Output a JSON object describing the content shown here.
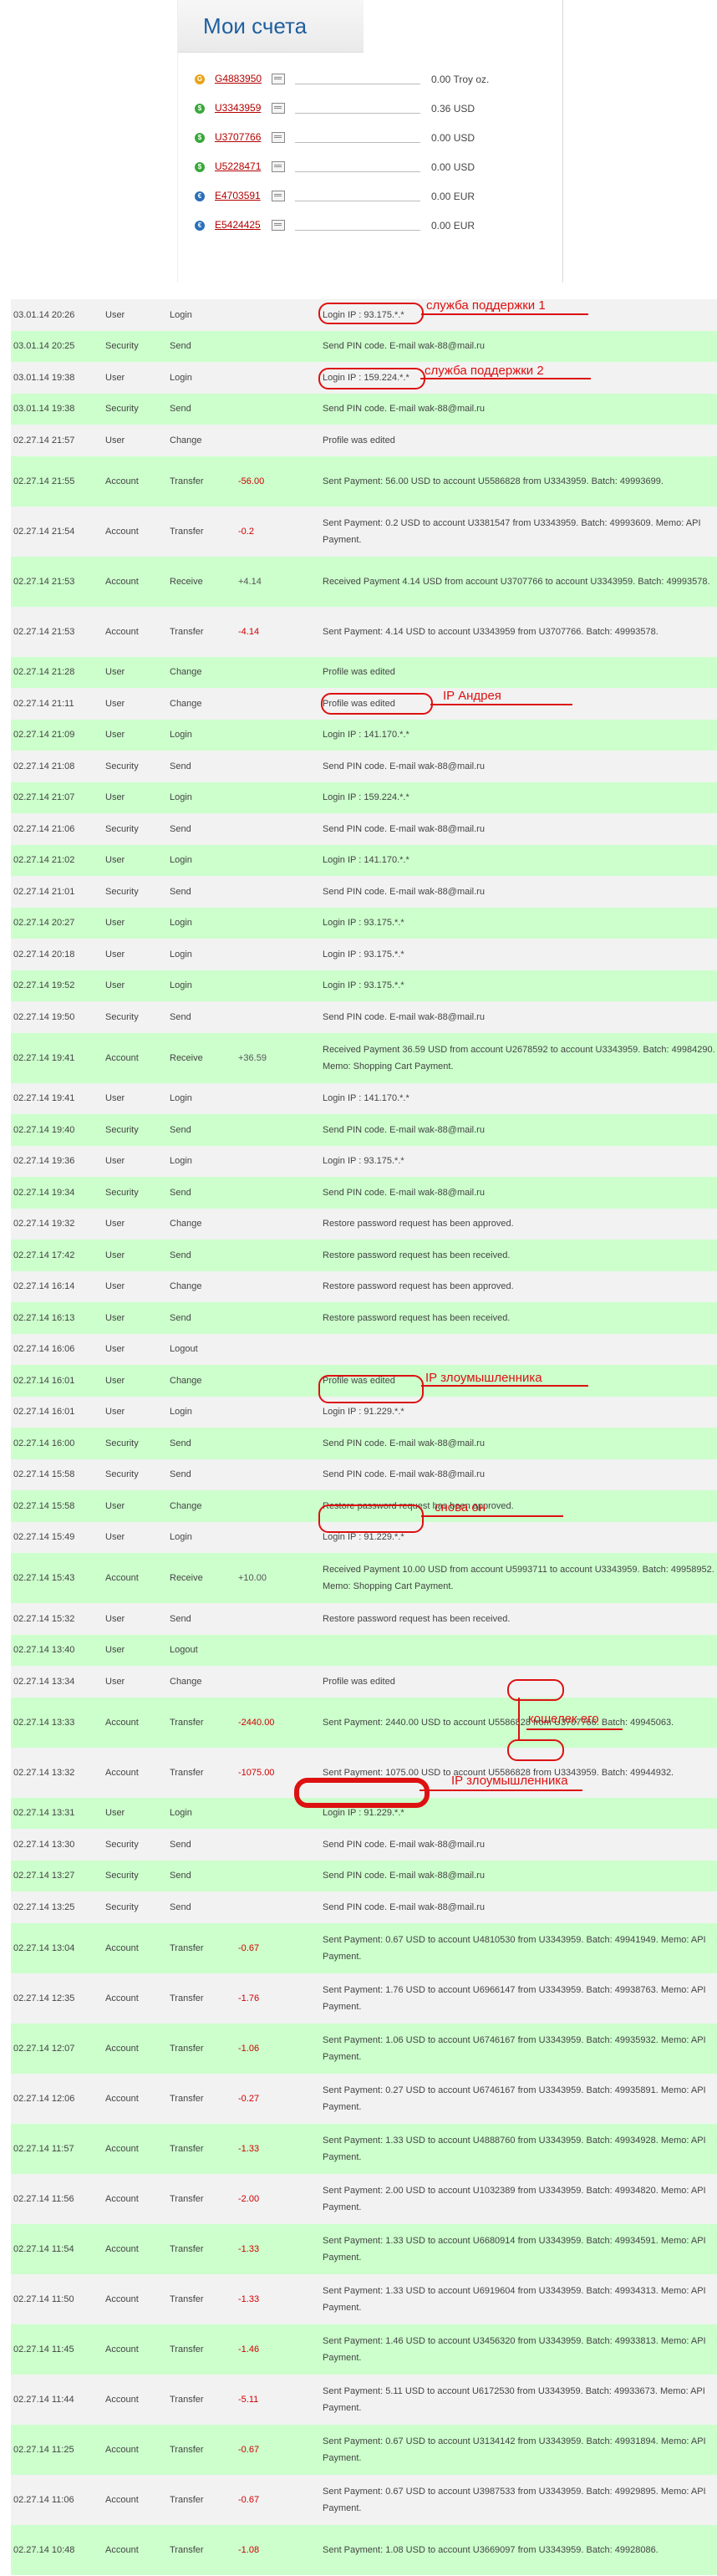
{
  "panel": {
    "title": "Мои счета",
    "accounts": [
      {
        "id": "G4883950",
        "balance": "0.00 Troy oz.",
        "kind": "g"
      },
      {
        "id": "U3343959",
        "balance": "0.36 USD",
        "kind": "u"
      },
      {
        "id": "U3707766",
        "balance": "0.00 USD",
        "kind": "u"
      },
      {
        "id": "U5228471",
        "balance": "0.00 USD",
        "kind": "u"
      },
      {
        "id": "E4703591",
        "balance": "0.00 EUR",
        "kind": "e"
      },
      {
        "id": "E5424425",
        "balance": "0.00 EUR",
        "kind": "e"
      }
    ]
  },
  "log": [
    {
      "date": "03.01.14 20:26",
      "group": "User",
      "action": "Login",
      "amount": "",
      "desc": "Login IP : 93.175.*.*",
      "c": "gray"
    },
    {
      "date": "03.01.14 20:25",
      "group": "Security",
      "action": "Send",
      "amount": "",
      "desc": "Send PIN code. E-mail wak-88@mail.ru",
      "c": "green"
    },
    {
      "date": "03.01.14 19:38",
      "group": "User",
      "action": "Login",
      "amount": "",
      "desc": "Login IP : 159.224.*.*",
      "c": "gray"
    },
    {
      "date": "03.01.14 19:38",
      "group": "Security",
      "action": "Send",
      "amount": "",
      "desc": "Send PIN code. E-mail wak-88@mail.ru",
      "c": "green"
    },
    {
      "date": "02.27.14 21:57",
      "group": "User",
      "action": "Change",
      "amount": "",
      "desc": "Profile was edited",
      "c": "gray"
    },
    {
      "date": "02.27.14 21:55",
      "group": "Account",
      "action": "Transfer",
      "amount": "-56.00",
      "desc": "Sent Payment: 56.00 USD to account U5586828 from U3343959. Batch: 49993699.",
      "c": "green"
    },
    {
      "date": "02.27.14 21:54",
      "group": "Account",
      "action": "Transfer",
      "amount": "-0.2",
      "desc": "Sent Payment: 0.2 USD to account U3381547 from U3343959. Batch: 49993609. Memo: API Payment.",
      "c": "gray"
    },
    {
      "date": "02.27.14 21:53",
      "group": "Account",
      "action": "Receive",
      "amount": "+4.14",
      "desc": "Received Payment 4.14 USD from account U3707766 to account U3343959. Batch: 49993578.",
      "c": "green"
    },
    {
      "date": "02.27.14 21:53",
      "group": "Account",
      "action": "Transfer",
      "amount": "-4.14",
      "desc": "Sent Payment: 4.14 USD to account U3343959 from U3707766. Batch: 49993578.",
      "c": "gray"
    },
    {
      "date": "02.27.14 21:28",
      "group": "User",
      "action": "Change",
      "amount": "",
      "desc": "Profile was edited",
      "c": "green"
    },
    {
      "date": "02.27.14 21:11",
      "group": "User",
      "action": "Change",
      "amount": "",
      "desc": "Profile was edited",
      "c": "gray"
    },
    {
      "date": "02.27.14 21:09",
      "group": "User",
      "action": "Login",
      "amount": "",
      "desc": "Login IP : 141.170.*.*",
      "c": "green"
    },
    {
      "date": "02.27.14 21:08",
      "group": "Security",
      "action": "Send",
      "amount": "",
      "desc": "Send PIN code. E-mail wak-88@mail.ru",
      "c": "gray"
    },
    {
      "date": "02.27.14 21:07",
      "group": "User",
      "action": "Login",
      "amount": "",
      "desc": "Login IP : 159.224.*.*",
      "c": "green"
    },
    {
      "date": "02.27.14 21:06",
      "group": "Security",
      "action": "Send",
      "amount": "",
      "desc": "Send PIN code. E-mail wak-88@mail.ru",
      "c": "gray"
    },
    {
      "date": "02.27.14 21:02",
      "group": "User",
      "action": "Login",
      "amount": "",
      "desc": "Login IP : 141.170.*.*",
      "c": "green"
    },
    {
      "date": "02.27.14 21:01",
      "group": "Security",
      "action": "Send",
      "amount": "",
      "desc": "Send PIN code. E-mail wak-88@mail.ru",
      "c": "gray"
    },
    {
      "date": "02.27.14 20:27",
      "group": "User",
      "action": "Login",
      "amount": "",
      "desc": "Login IP : 93.175.*.*",
      "c": "green"
    },
    {
      "date": "02.27.14 20:18",
      "group": "User",
      "action": "Login",
      "amount": "",
      "desc": "Login IP : 93.175.*.*",
      "c": "gray"
    },
    {
      "date": "02.27.14 19:52",
      "group": "User",
      "action": "Login",
      "amount": "",
      "desc": "Login IP : 93.175.*.*",
      "c": "green"
    },
    {
      "date": "02.27.14 19:50",
      "group": "Security",
      "action": "Send",
      "amount": "",
      "desc": "Send PIN code. E-mail wak-88@mail.ru",
      "c": "gray"
    },
    {
      "date": "02.27.14 19:41",
      "group": "Account",
      "action": "Receive",
      "amount": "+36.59",
      "desc": "Received Payment 36.59 USD from account U2678592 to account U3343959. Batch: 49984290. Memo: Shopping Cart Payment.",
      "c": "green"
    },
    {
      "date": "02.27.14 19:41",
      "group": "User",
      "action": "Login",
      "amount": "",
      "desc": "Login IP : 141.170.*.*",
      "c": "gray"
    },
    {
      "date": "02.27.14 19:40",
      "group": "Security",
      "action": "Send",
      "amount": "",
      "desc": "Send PIN code. E-mail wak-88@mail.ru",
      "c": "green"
    },
    {
      "date": "02.27.14 19:36",
      "group": "User",
      "action": "Login",
      "amount": "",
      "desc": "Login IP : 93.175.*.*",
      "c": "gray"
    },
    {
      "date": "02.27.14 19:34",
      "group": "Security",
      "action": "Send",
      "amount": "",
      "desc": "Send PIN code. E-mail wak-88@mail.ru",
      "c": "green"
    },
    {
      "date": "02.27.14 19:32",
      "group": "User",
      "action": "Change",
      "amount": "",
      "desc": "Restore password request has been approved.",
      "c": "gray"
    },
    {
      "date": "02.27.14 17:42",
      "group": "User",
      "action": "Send",
      "amount": "",
      "desc": "Restore password request has been received.",
      "c": "green"
    },
    {
      "date": "02.27.14 16:14",
      "group": "User",
      "action": "Change",
      "amount": "",
      "desc": "Restore password request has been approved.",
      "c": "gray"
    },
    {
      "date": "02.27.14 16:13",
      "group": "User",
      "action": "Send",
      "amount": "",
      "desc": "Restore password request has been received.",
      "c": "green"
    },
    {
      "date": "02.27.14 16:06",
      "group": "User",
      "action": "Logout",
      "amount": "",
      "desc": "",
      "c": "gray"
    },
    {
      "date": "02.27.14 16:01",
      "group": "User",
      "action": "Change",
      "amount": "",
      "desc": "Profile was edited",
      "c": "green"
    },
    {
      "date": "02.27.14 16:01",
      "group": "User",
      "action": "Login",
      "amount": "",
      "desc": "Login IP : 91.229.*.*",
      "c": "gray"
    },
    {
      "date": "02.27.14 16:00",
      "group": "Security",
      "action": "Send",
      "amount": "",
      "desc": "Send PIN code. E-mail wak-88@mail.ru",
      "c": "green"
    },
    {
      "date": "02.27.14 15:58",
      "group": "Security",
      "action": "Send",
      "amount": "",
      "desc": "Send PIN code. E-mail wak-88@mail.ru",
      "c": "gray"
    },
    {
      "date": "02.27.14 15:58",
      "group": "User",
      "action": "Change",
      "amount": "",
      "desc": "Restore password request has been approved.",
      "c": "green"
    },
    {
      "date": "02.27.14 15:49",
      "group": "User",
      "action": "Login",
      "amount": "",
      "desc": "Login IP : 91.229.*.*",
      "c": "gray"
    },
    {
      "date": "02.27.14 15:43",
      "group": "Account",
      "action": "Receive",
      "amount": "+10.00",
      "desc": "Received Payment 10.00 USD from account U5993711 to account U3343959. Batch: 49958952. Memo: Shopping Cart Payment.",
      "c": "green"
    },
    {
      "date": "02.27.14 15:32",
      "group": "User",
      "action": "Send",
      "amount": "",
      "desc": "Restore password request has been received.",
      "c": "gray"
    },
    {
      "date": "02.27.14 13:40",
      "group": "User",
      "action": "Logout",
      "amount": "",
      "desc": "",
      "c": "green"
    },
    {
      "date": "02.27.14 13:34",
      "group": "User",
      "action": "Change",
      "amount": "",
      "desc": "Profile was edited",
      "c": "gray"
    },
    {
      "date": "02.27.14 13:33",
      "group": "Account",
      "action": "Transfer",
      "amount": "-2440.00",
      "desc": "Sent Payment: 2440.00 USD to account U5586828 from U3707766. Batch: 49945063.",
      "c": "green"
    },
    {
      "date": "02.27.14 13:32",
      "group": "Account",
      "action": "Transfer",
      "amount": "-1075.00",
      "desc": "Sent Payment: 1075.00 USD to account U5586828 from U3343959. Batch: 49944932.",
      "c": "gray"
    },
    {
      "date": "02.27.14 13:31",
      "group": "User",
      "action": "Login",
      "amount": "",
      "desc": "Login IP : 91.229.*.*",
      "c": "green"
    },
    {
      "date": "02.27.14 13:30",
      "group": "Security",
      "action": "Send",
      "amount": "",
      "desc": "Send PIN code. E-mail wak-88@mail.ru",
      "c": "gray"
    },
    {
      "date": "02.27.14 13:27",
      "group": "Security",
      "action": "Send",
      "amount": "",
      "desc": "Send PIN code. E-mail wak-88@mail.ru",
      "c": "green"
    },
    {
      "date": "02.27.14 13:25",
      "group": "Security",
      "action": "Send",
      "amount": "",
      "desc": "Send PIN code. E-mail wak-88@mail.ru",
      "c": "gray"
    },
    {
      "date": "02.27.14 13:04",
      "group": "Account",
      "action": "Transfer",
      "amount": "-0.67",
      "desc": "Sent Payment: 0.67 USD to account U4810530 from U3343959. Batch: 49941949. Memo: API Payment.",
      "c": "green"
    },
    {
      "date": "02.27.14 12:35",
      "group": "Account",
      "action": "Transfer",
      "amount": "-1.76",
      "desc": "Sent Payment: 1.76 USD to account U6966147 from U3343959. Batch: 49938763. Memo: API Payment.",
      "c": "gray"
    },
    {
      "date": "02.27.14 12:07",
      "group": "Account",
      "action": "Transfer",
      "amount": "-1.06",
      "desc": "Sent Payment: 1.06 USD to account U6746167 from U3343959. Batch: 49935932. Memo: API Payment.",
      "c": "green"
    },
    {
      "date": "02.27.14 12:06",
      "group": "Account",
      "action": "Transfer",
      "amount": "-0.27",
      "desc": "Sent Payment: 0.27 USD to account U6746167 from U3343959. Batch: 49935891. Memo: API Payment.",
      "c": "gray"
    },
    {
      "date": "02.27.14 11:57",
      "group": "Account",
      "action": "Transfer",
      "amount": "-1.33",
      "desc": "Sent Payment: 1.33 USD to account U4888760 from U3343959. Batch: 49934928. Memo: API Payment.",
      "c": "green"
    },
    {
      "date": "02.27.14 11:56",
      "group": "Account",
      "action": "Transfer",
      "amount": "-2.00",
      "desc": "Sent Payment: 2.00 USD to account U1032389 from U3343959. Batch: 49934820. Memo: API Payment.",
      "c": "gray"
    },
    {
      "date": "02.27.14 11:54",
      "group": "Account",
      "action": "Transfer",
      "amount": "-1.33",
      "desc": "Sent Payment: 1.33 USD to account U6680914 from U3343959. Batch: 49934591. Memo: API Payment.",
      "c": "green"
    },
    {
      "date": "02.27.14 11:50",
      "group": "Account",
      "action": "Transfer",
      "amount": "-1.33",
      "desc": "Sent Payment: 1.33 USD to account U6919604 from U3343959. Batch: 49934313. Memo: API Payment.",
      "c": "gray"
    },
    {
      "date": "02.27.14 11:45",
      "group": "Account",
      "action": "Transfer",
      "amount": "-1.46",
      "desc": "Sent Payment: 1.46 USD to account U3456320 from U3343959. Batch: 49933813. Memo: API Payment.",
      "c": "green"
    },
    {
      "date": "02.27.14 11:44",
      "group": "Account",
      "action": "Transfer",
      "amount": "-5.11",
      "desc": "Sent Payment: 5.11 USD to account U6172530 from U3343959. Batch: 49933673. Memo: API Payment.",
      "c": "gray"
    },
    {
      "date": "02.27.14 11:25",
      "group": "Account",
      "action": "Transfer",
      "amount": "-0.67",
      "desc": "Sent Payment: 0.67 USD to account U3134142 from U3343959. Batch: 49931894. Memo: API Payment.",
      "c": "green"
    },
    {
      "date": "02.27.14 11:06",
      "group": "Account",
      "action": "Transfer",
      "amount": "-0.67",
      "desc": "Sent Payment: 0.67 USD to account U3987533 from U3343959. Batch: 49929895. Memo: API Payment.",
      "c": "gray"
    },
    {
      "date": "02.27.14 10:48",
      "group": "Account",
      "action": "Transfer",
      "amount": "-1.08",
      "desc": "Sent Payment: 1.08 USD to account U3669097 from U3343959. Batch: 49928086.",
      "c": "green"
    }
  ],
  "annotations": {
    "support1": "служба поддержки 1",
    "support2": "служба поддержки 2",
    "andrey": "IP Андрея",
    "attacker1": "IP злоумышленника",
    "again": "снова он",
    "wallet": "кошелек его",
    "attacker2": "IP злоумышленника"
  },
  "colors": {
    "green_row": "#ccffcc",
    "gray_row": "#f2f2f2",
    "annotation": "#dd1111",
    "negative_amount": "#d00000",
    "title": "#1f5f9f"
  }
}
